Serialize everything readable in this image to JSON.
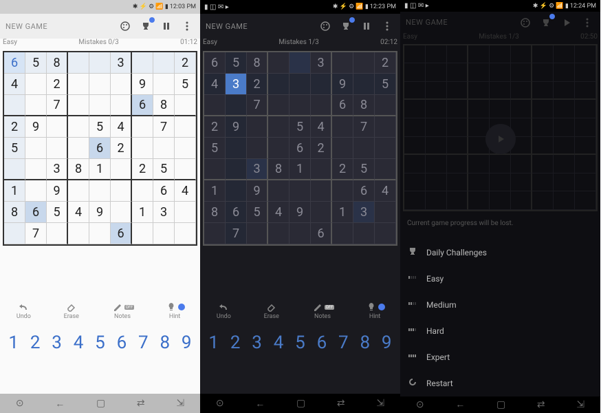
{
  "screens": [
    {
      "theme": "light",
      "status": {
        "left": "",
        "icons": "✱ ⚡ ⚙ 📶 ▮",
        "time": "12:03 PM"
      },
      "header": "NEW GAME",
      "info": {
        "difficulty": "Easy",
        "mistakes": "Mistakes 0/3",
        "time": "01:12"
      },
      "grid": [
        [
          "6",
          "5",
          "8",
          "",
          "",
          "3",
          "",
          "",
          "2"
        ],
        [
          "4",
          "",
          "2",
          "",
          "",
          "",
          "9",
          "",
          "5"
        ],
        [
          "",
          "",
          "7",
          "",
          "",
          "",
          "6",
          "8",
          ""
        ],
        [
          "2",
          "9",
          "",
          "",
          "5",
          "4",
          "",
          "7",
          ""
        ],
        [
          "5",
          "",
          "",
          "",
          "6",
          "2",
          "",
          "",
          ""
        ],
        [
          "",
          "",
          "3",
          "8",
          "1",
          "",
          "2",
          "5",
          ""
        ],
        [
          "1",
          "",
          "9",
          "",
          "",
          "",
          "",
          "6",
          "4"
        ],
        [
          "8",
          "6",
          "5",
          "4",
          "9",
          "",
          "1",
          "3",
          ""
        ],
        [
          "",
          "7",
          "",
          "",
          "",
          "6",
          "",
          "",
          ""
        ]
      ],
      "hl_cells": [
        [
          0,
          0
        ]
      ],
      "same_cells": [
        [
          2,
          6
        ],
        [
          4,
          4
        ],
        [
          7,
          1
        ],
        [
          8,
          5
        ]
      ],
      "peer_row": 0,
      "peer_col": 0,
      "numpad": [
        "1",
        "2",
        "3",
        "4",
        "5",
        "6",
        "7",
        "8",
        "9"
      ]
    },
    {
      "theme": "dark",
      "status": {
        "left": "▮ ◫ ✉ ▸",
        "icons": "✱ ⚡ ⚙ 📶 ▮",
        "time": "12:23 PM"
      },
      "header": "NEW GAME",
      "info": {
        "difficulty": "Easy",
        "mistakes": "Mistakes 1/3",
        "time": "02:12"
      },
      "grid": [
        [
          "6",
          "5",
          "8",
          "",
          "",
          "3",
          "",
          "",
          "2"
        ],
        [
          "4",
          "3",
          "2",
          "",
          "",
          "",
          "9",
          "",
          "5"
        ],
        [
          "",
          "",
          "7",
          "",
          "",
          "",
          "6",
          "8",
          ""
        ],
        [
          "2",
          "9",
          "",
          "",
          "5",
          "4",
          "",
          "7",
          ""
        ],
        [
          "5",
          "",
          "",
          "",
          "6",
          "2",
          "",
          "",
          ""
        ],
        [
          "",
          "",
          "3",
          "8",
          "1",
          "",
          "2",
          "5",
          ""
        ],
        [
          "1",
          "",
          "9",
          "",
          "",
          "",
          "",
          "6",
          "4"
        ],
        [
          "8",
          "6",
          "5",
          "4",
          "9",
          "",
          "1",
          "3",
          ""
        ],
        [
          "",
          "7",
          "",
          "",
          "",
          "6",
          "",
          "",
          ""
        ]
      ],
      "sel": [
        1,
        1
      ],
      "same_cells": [
        [
          0,
          4
        ],
        [
          5,
          2
        ],
        [
          7,
          7
        ]
      ],
      "peer_row": 1,
      "peer_col": 1,
      "numpad": [
        "1",
        "2",
        "3",
        "4",
        "5",
        "6",
        "7",
        "8",
        "9"
      ]
    },
    {
      "theme": "darker",
      "status": {
        "left": "▮ ◫ ✉ ▸",
        "icons": "✱ ⚡ ⚙ 📶 ▮",
        "time": "12:24 PM"
      },
      "header": "NEW GAME",
      "info": {
        "difficulty": "Easy",
        "mistakes": "Mistakes 1/3",
        "time": "02:50"
      },
      "paused": true,
      "menu_warning": "Current game progress will be lost.",
      "menu": [
        {
          "icon": "trophy",
          "label": "Daily Challenges"
        },
        {
          "icon": "diff1",
          "label": "Easy"
        },
        {
          "icon": "diff2",
          "label": "Medium"
        },
        {
          "icon": "diff3",
          "label": "Hard"
        },
        {
          "icon": "diff4",
          "label": "Expert"
        },
        {
          "icon": "restart",
          "label": "Restart"
        }
      ]
    }
  ],
  "tools": [
    {
      "name": "undo",
      "label": "Undo"
    },
    {
      "name": "erase",
      "label": "Erase"
    },
    {
      "name": "notes",
      "label": "Notes",
      "badge": "OFF"
    },
    {
      "name": "hint",
      "label": "Hint",
      "dot": true
    }
  ],
  "nav": [
    "⊙",
    "←",
    "▢",
    "⇄",
    "⇲"
  ]
}
